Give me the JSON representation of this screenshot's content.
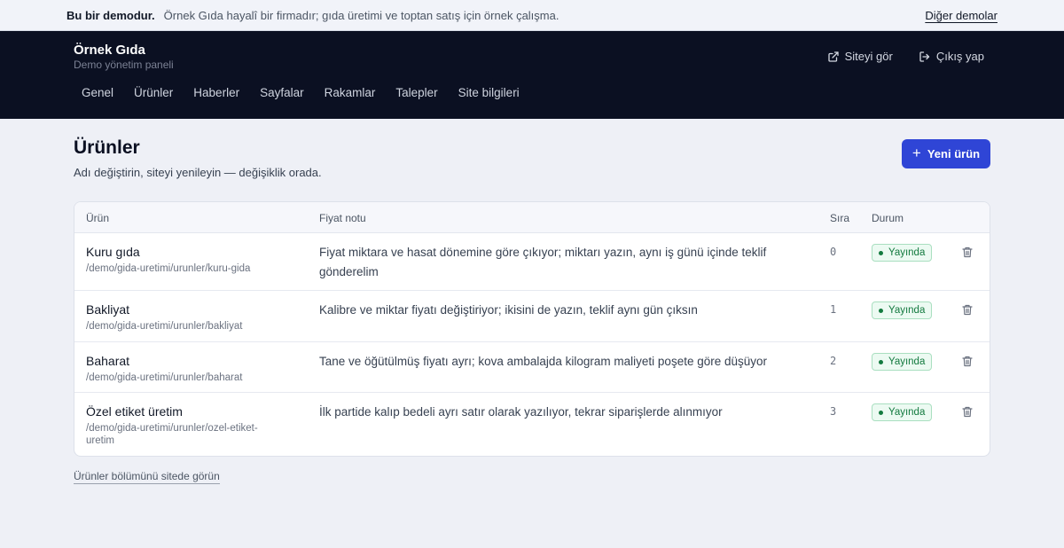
{
  "banner": {
    "strong": "Bu bir demodur.",
    "description": "Örnek Gıda hayalî bir firmadır; gıda üretimi ve toptan satış için örnek çalışma.",
    "other_demos": "Diğer demolar"
  },
  "header": {
    "brand": "Örnek Gıda",
    "subtitle": "Demo yönetim paneli",
    "view_site": "Siteyi gör",
    "logout": "Çıkış yap",
    "nav": [
      "Genel",
      "Ürünler",
      "Haberler",
      "Sayfalar",
      "Rakamlar",
      "Talepler",
      "Site bilgileri"
    ]
  },
  "page": {
    "title": "Ürünler",
    "subtitle": "Adı değiştirin, siteyi yenileyin — değişiklik orada.",
    "new_button": "Yeni ürün"
  },
  "table": {
    "columns": [
      "Ürün",
      "Fiyat notu",
      "Sıra",
      "Durum"
    ],
    "rows": [
      {
        "name": "Kuru gıda",
        "path": "/demo/gida-uretimi/urunler/kuru-gida",
        "note": "Fiyat miktara ve hasat dönemine göre çıkıyor; miktarı yazın, aynı iş günü içinde teklif gönderelim",
        "order": "0",
        "status": "Yayında"
      },
      {
        "name": "Bakliyat",
        "path": "/demo/gida-uretimi/urunler/bakliyat",
        "note": "Kalibre ve miktar fiyatı değiştiriyor; ikisini de yazın, teklif aynı gün çıksın",
        "order": "1",
        "status": "Yayında"
      },
      {
        "name": "Baharat",
        "path": "/demo/gida-uretimi/urunler/baharat",
        "note": "Tane ve öğütülmüş fiyatı ayrı; kova ambalajda kilogram maliyeti poşete göre düşüyor",
        "order": "2",
        "status": "Yayında"
      },
      {
        "name": "Özel etiket üretim",
        "path": "/demo/gida-uretimi/urunler/ozel-etiket-uretim",
        "note": "İlk partide kalıp bedeli ayrı satır olarak yazılıyor, tekrar siparişlerde alınmıyor",
        "order": "3",
        "status": "Yayında"
      }
    ]
  },
  "footer": {
    "link": "Ürünler bölümünü sitede görün"
  },
  "colors": {
    "header_bg": "#0b1022",
    "accent": "#2f45d6",
    "status_green": "#137a3f"
  }
}
